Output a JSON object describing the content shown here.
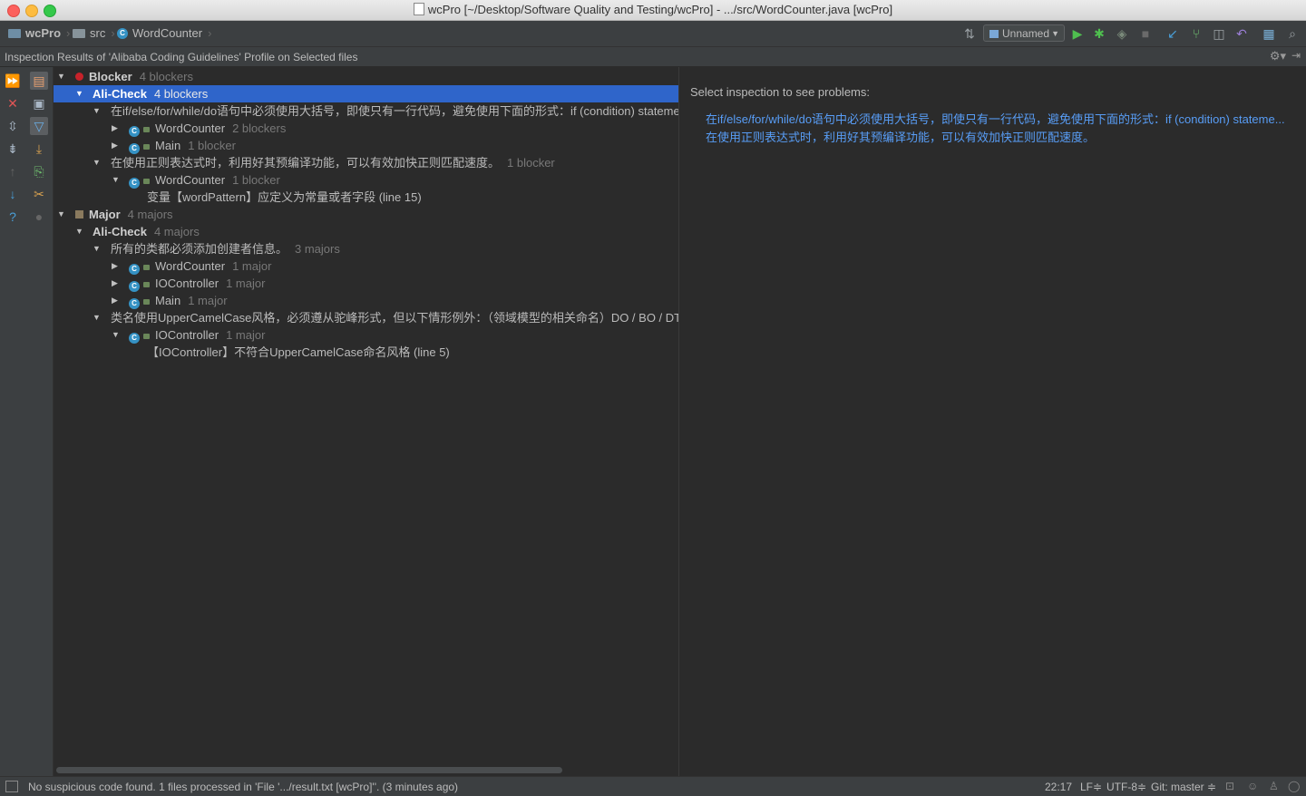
{
  "window": {
    "title": "wcPro [~/Desktop/Software Quality and Testing/wcPro] - .../src/WordCounter.java [wcPro]"
  },
  "breadcrumb": {
    "project": "wcPro",
    "folder": "src",
    "file": "WordCounter"
  },
  "toolbar": {
    "run_config": "Unnamed"
  },
  "panel": {
    "title": "Inspection Results of 'Alibaba Coding Guidelines' Profile on Selected files"
  },
  "tree": {
    "blocker": {
      "label": "Blocker",
      "count": "4 blockers"
    },
    "blocker_group": {
      "label": "Ali-Check",
      "count": "4 blockers"
    },
    "b_rule1": {
      "label": "在if/else/for/while/do语句中必须使用大括号，即使只有一行代码，避免使用下面的形式：if (condition) statements;"
    },
    "b_rule1_wc": {
      "label": "WordCounter",
      "count": "2 blockers"
    },
    "b_rule1_main": {
      "label": "Main",
      "count": "1 blocker"
    },
    "b_rule2": {
      "label": "在使用正则表达式时，利用好其预编译功能，可以有效加快正则匹配速度。",
      "count": "1 blocker"
    },
    "b_rule2_wc": {
      "label": "WordCounter",
      "count": "1 blocker"
    },
    "b_rule2_problem": {
      "label": "变量【wordPattern】应定义为常量或者字段 (line 15)"
    },
    "major": {
      "label": "Major",
      "count": "4 majors"
    },
    "major_group": {
      "label": "Ali-Check",
      "count": "4 majors"
    },
    "m_rule1": {
      "label": "所有的类都必须添加创建者信息。",
      "count": "3 majors"
    },
    "m_rule1_wc": {
      "label": "WordCounter",
      "count": "1 major"
    },
    "m_rule1_io": {
      "label": "IOController",
      "count": "1 major"
    },
    "m_rule1_main": {
      "label": "Main",
      "count": "1 major"
    },
    "m_rule2": {
      "label": "类名使用UpperCamelCase风格，必须遵从驼峰形式，但以下情形例外：（领域模型的相关命名）DO / BO / DTO"
    },
    "m_rule2_io": {
      "label": "IOController",
      "count": "1 major"
    },
    "m_rule2_problem": {
      "label": "【IOController】不符合UpperCamelCase命名风格 (line 5)"
    }
  },
  "details": {
    "title": "Select inspection to see problems:",
    "links": [
      "在if/else/for/while/do语句中必须使用大括号，即使只有一行代码，避免使用下面的形式：if (condition) stateme...",
      "在使用正则表达式时，利用好其预编译功能，可以有效加快正则匹配速度。"
    ]
  },
  "status": {
    "message": "No suspicious code found. 1 files processed in 'File '.../result.txt [wcPro]''. (3 minutes ago)",
    "position": "22:17",
    "line_sep": "LF≑",
    "encoding": "UTF-8≑",
    "vcs": "Git: master ≑"
  }
}
